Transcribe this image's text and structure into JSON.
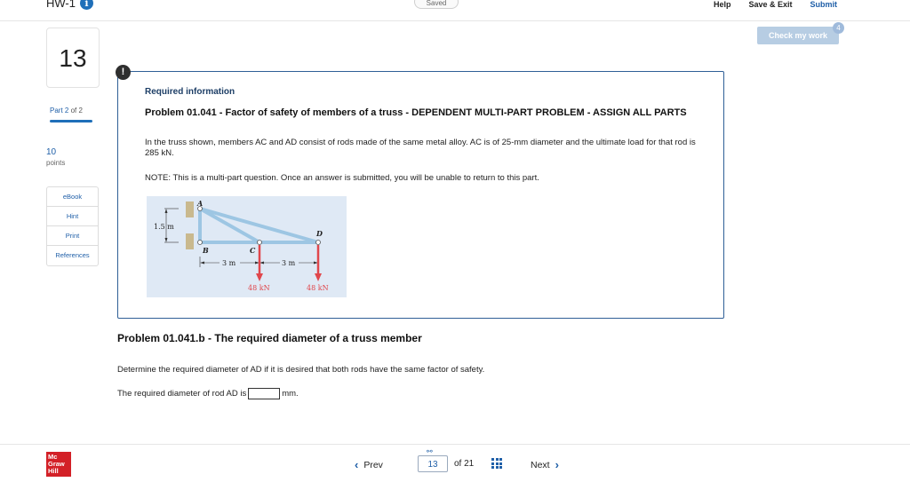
{
  "header": {
    "assignment_title": "HW-1",
    "saved_status": "Saved",
    "help_label": "Help",
    "save_exit_label": "Save & Exit",
    "submit_label": "Submit",
    "check_work_label": "Check my work",
    "check_work_badge": "4"
  },
  "sidebar": {
    "question_number": "13",
    "part_current": "Part 2",
    "part_of": "of 2",
    "part_progress": 1.0,
    "points_value": "10",
    "points_label": "points",
    "tools": [
      "eBook",
      "Hint",
      "Print",
      "References"
    ]
  },
  "required_info": {
    "alert_glyph": "!",
    "heading": "Required information",
    "problem_title": "Problem 01.041 - Factor of safety of members of a truss - DEPENDENT MULTI-PART PROBLEM - ASSIGN ALL PARTS",
    "problem_text": "In the truss shown, members AC and AD consist of rods made of the same metal alloy. AC is of 25-mm diameter and the ultimate load for that rod is 285 kN.",
    "note": "NOTE: This is a multi-part question. Once an answer is submitted, you will be unable to return to this part."
  },
  "figure": {
    "label_A": "A",
    "label_B": "B",
    "label_C": "C",
    "label_D": "D",
    "height_label": "1.5 m",
    "span_1_label": "3 m",
    "span_2_label": "3 m",
    "load_1_label": "48 kN",
    "load_2_label": "48 kN"
  },
  "question": {
    "sub_title": "Problem 01.041.b - The required diameter of a truss member",
    "prompt": "Determine the required diameter of AD if it is desired that both rods have the same factor of safety.",
    "answer_prefix": "The required diameter of rod AD is",
    "answer_value": "",
    "answer_unit": "mm."
  },
  "footer": {
    "logo_line1": "Mc",
    "logo_line2": "Graw",
    "logo_line3": "Hill",
    "prev_label": "Prev",
    "current_page": "13",
    "page_total": "of 21",
    "next_label": "Next"
  },
  "colors": {
    "accent": "#1f5fa8",
    "box_border": "#2f5f96",
    "logo_red": "#d32027",
    "load_arrow": "#e0474c"
  }
}
